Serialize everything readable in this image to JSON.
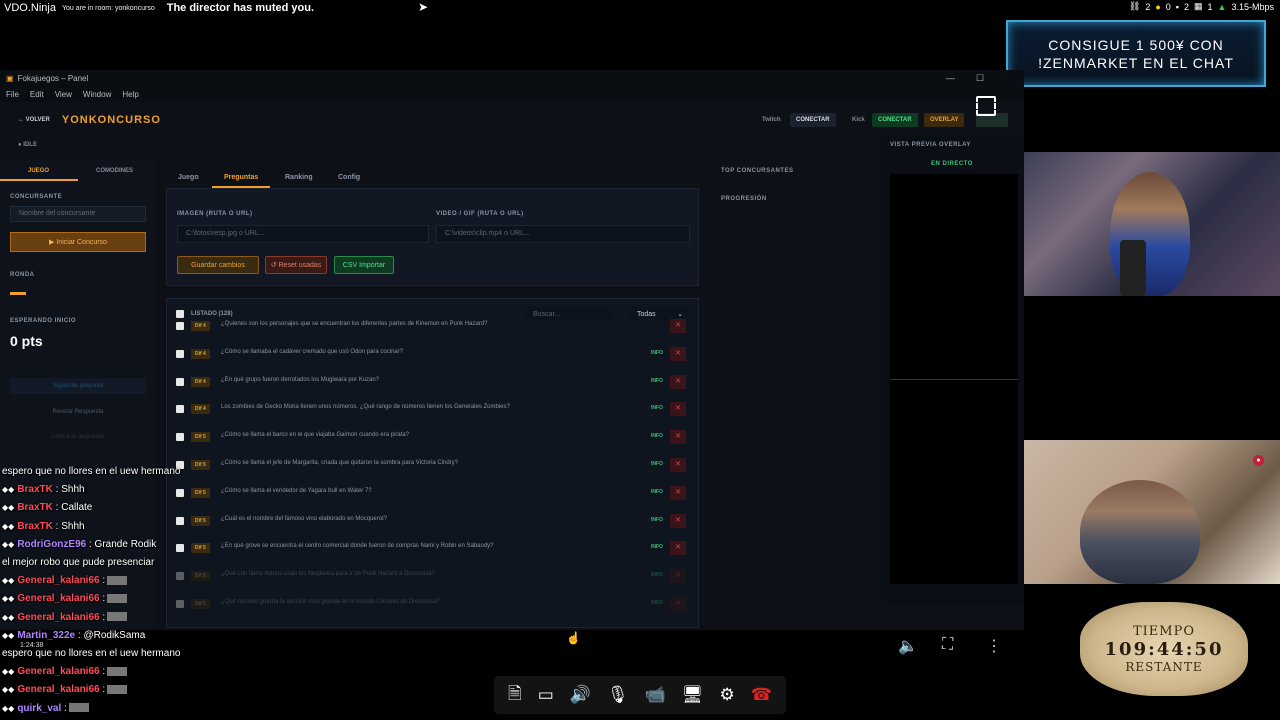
{
  "topbar": {
    "brand": "VDO.Ninja",
    "room": "You are in room: yonkoncurso",
    "notice": "The director has muted you.",
    "stats": [
      "2",
      "0",
      "2",
      "1",
      "3.15-Mbps"
    ]
  },
  "promo": {
    "line1": "CONSIGUE 1 500¥ CON",
    "line2": "!ZENMARKET EN EL CHAT"
  },
  "window": {
    "title": "Fokajuegos – Panel",
    "menu": [
      "File",
      "Edit",
      "View",
      "Window",
      "Help"
    ],
    "back": "← VOLVER",
    "app_title": "YONKONCURSO",
    "header_buttons": {
      "twitch": "Twitch",
      "connect1": "CONECTAR",
      "kick": "Kick",
      "connect2": "CONECTAR",
      "overlay": "OVERLAY"
    },
    "status": "● IDLE"
  },
  "left": {
    "tab_game": "JUEGO",
    "tab_cond": "COMODINES",
    "contestant_label": "CONCURSANTE",
    "contestant_placeholder": "Nombre del concursante",
    "start_btn": "▶ Iniciar Concurso",
    "round_label": "RONDA",
    "waiting_label": "ESPERANDO INICIO",
    "points": "0 pts",
    "next_q": "Siguiente pregunta",
    "reveal": "Revelar Respuesta",
    "ready": "Listo a la respuesta"
  },
  "center": {
    "tabs": [
      "Juego",
      "Preguntas",
      "Ranking",
      "Config"
    ],
    "image_label": "IMAGEN (RUTA O URL)",
    "image_placeholder": "C:\\fotos\\resp.jpg o URL...",
    "video_label": "VIDEO / GIF (RUTA O URL)",
    "video_placeholder": "C:\\videos\\clip.mp4 o URL...",
    "save": "Guardar cambios",
    "reset": "↺ Reset usadas",
    "csv": "CSV Importar",
    "list_label": "LISTADO (128)",
    "search_placeholder": "Buscar...",
    "filter": "Todas",
    "rows": [
      {
        "diff": "Dif 4",
        "q": "¿Quienes son los personajes que se encuentran los diferentes partes de Kinemon en Punk Hazard?",
        "info": ""
      },
      {
        "diff": "Dif 4",
        "q": "¿Cómo se llamaba el cadáver cremado que usó Odon para cocinar?",
        "info": "INFO"
      },
      {
        "diff": "Dif 4",
        "q": "¿En qué grupo fueron derrotados los Mugiwara por Kuzan?",
        "info": "INFO"
      },
      {
        "diff": "Dif 4",
        "q": "Los zombies de Gecko Moria tienen unos números. ¿Qué rango de números tienen los Generales Zombies?",
        "info": "INFO"
      },
      {
        "diff": "Dif 5",
        "q": "¿Cómo se llama el barco en el que viajaba Gaimon cuando era pirata?",
        "info": "INFO"
      },
      {
        "diff": "Dif 5",
        "q": "¿Cómo se llama el jefe de Margarita, criada que quitaron la sombra para Victoria Cindry?",
        "info": "INFO"
      },
      {
        "diff": "Dif 5",
        "q": "¿Cómo se llama el vendedor de Yagara bull en Water 7?",
        "info": "INFO"
      },
      {
        "diff": "Dif 5",
        "q": "¿Cuál es el nombre del famoso vino elaborado en Mocquerot?",
        "info": "INFO"
      },
      {
        "diff": "Dif 5",
        "q": "¿En qué grove se encuentra el centro comercial donde fueron de compras Nami y Robin en Sabaody?",
        "info": "INFO"
      },
      {
        "diff": "Dif 5",
        "q": "¿Qué con tierra manos usan los Mugiwara para ir de Punk Hazard a Dressrosa?",
        "info": "INFO"
      },
      {
        "diff": "Dif 5",
        "q": "¿Qué número guarda la sección más grande en el mundo Césares de Dressrosa?",
        "info": "INFO"
      }
    ]
  },
  "right": {
    "top_label": "TOP CONCURSANTES",
    "progress_label": "PROGRESIÓN",
    "preview_label": "VISTA PREVIA OVERLAY",
    "live_label": "EN DIRECTO"
  },
  "timer": {
    "label": "TIEMPO",
    "value": "109:44:50",
    "suffix": "RESTANTE"
  },
  "chat": [
    {
      "user": "",
      "msg": "espero que no llores en el uew hermano",
      "color": "#ffffff"
    },
    {
      "user": "BraxTK",
      "msg": ": Shhh",
      "color": "#ff4a5a"
    },
    {
      "user": "BraxTK",
      "msg": ": Callate",
      "color": "#ff4a5a"
    },
    {
      "user": "BraxTK",
      "msg": ": Shhh",
      "color": "#ff4a5a"
    },
    {
      "user": "RodriGonzE96",
      "msg": ": Grande Rodik",
      "color": "#b084ff"
    },
    {
      "user": "",
      "msg": "el mejor robo que pude presenciar",
      "color": "#ffffff"
    },
    {
      "user": "General_kalani66",
      "msg": ":",
      "color": "#ff4a5a"
    },
    {
      "user": "General_kalani66",
      "msg": ":",
      "color": "#ff4a5a"
    },
    {
      "user": "General_kalani66",
      "msg": ":",
      "color": "#ff4a5a"
    },
    {
      "user": "Martin_322e",
      "msg": ": @RodikSama",
      "color": "#b084ff"
    },
    {
      "user": "",
      "msg": "espero que no llores en el uew hermano",
      "color": "#ffffff"
    },
    {
      "user": "General_kalani66",
      "msg": ":",
      "color": "#ff4a5a"
    },
    {
      "user": "General_kalani66",
      "msg": ":",
      "color": "#ff4a5a"
    },
    {
      "user": "quirk_val",
      "msg": ":",
      "color": "#b084ff"
    }
  ],
  "chat_timestamp": "1:24:38",
  "colors": {
    "accent": "#f0a02a",
    "success": "#3ac078",
    "danger": "#d24a56",
    "promo_border": "#3ea9d8"
  }
}
